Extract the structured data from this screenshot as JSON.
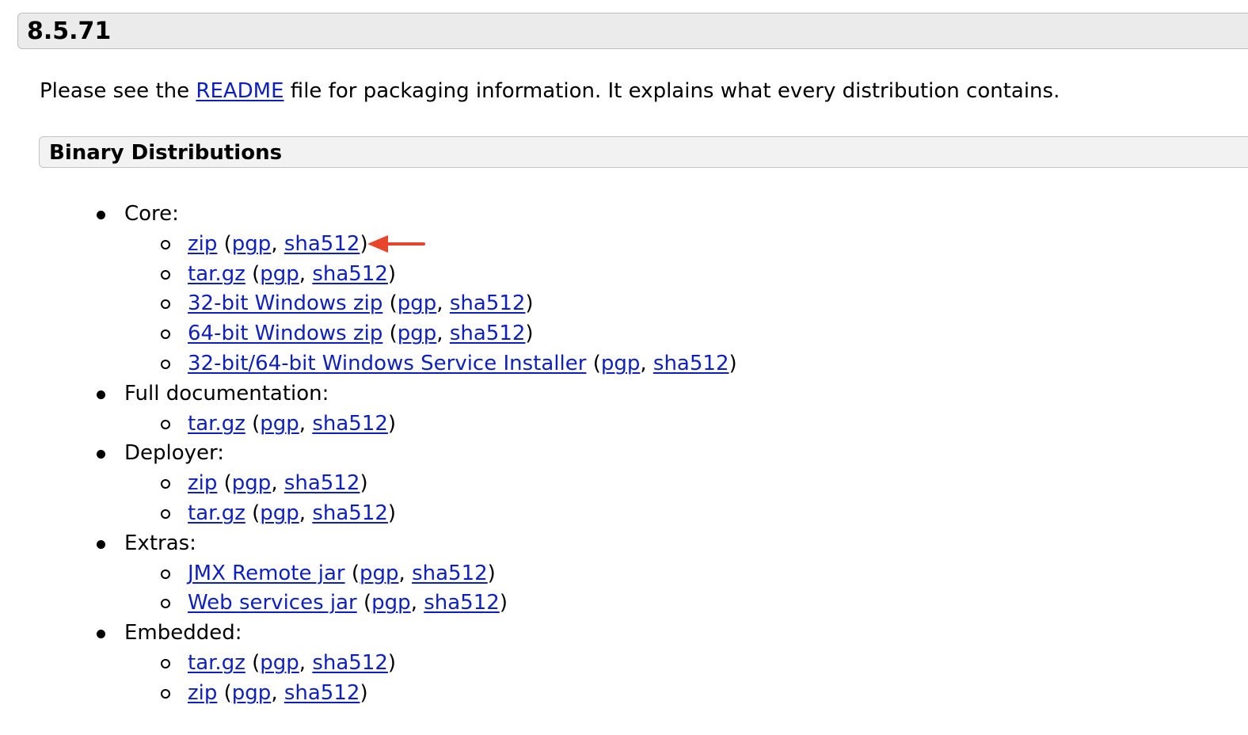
{
  "version": {
    "title": "8.5.71"
  },
  "intro": {
    "before": "Please see the ",
    "link": "README",
    "after": " file for packaging information. It explains what every distribution contains."
  },
  "section": {
    "title": "Binary Distributions"
  },
  "groups": [
    {
      "label": "Core:",
      "items": [
        {
          "name": "zip",
          "pgp": "pgp",
          "sha": "sha512"
        },
        {
          "name": "tar.gz",
          "pgp": "pgp",
          "sha": "sha512"
        },
        {
          "name": "32-bit Windows zip",
          "pgp": "pgp",
          "sha": "sha512"
        },
        {
          "name": "64-bit Windows zip",
          "pgp": "pgp",
          "sha": "sha512"
        },
        {
          "name": "32-bit/64-bit Windows Service Installer",
          "pgp": "pgp",
          "sha": "sha512"
        }
      ]
    },
    {
      "label": "Full documentation:",
      "items": [
        {
          "name": "tar.gz",
          "pgp": "pgp",
          "sha": "sha512"
        }
      ]
    },
    {
      "label": "Deployer:",
      "items": [
        {
          "name": "zip",
          "pgp": "pgp",
          "sha": "sha512"
        },
        {
          "name": "tar.gz",
          "pgp": "pgp",
          "sha": "sha512"
        }
      ]
    },
    {
      "label": "Extras:",
      "items": [
        {
          "name": "JMX Remote jar",
          "pgp": "pgp",
          "sha": "sha512"
        },
        {
          "name": "Web services jar",
          "pgp": "pgp",
          "sha": "sha512"
        }
      ]
    },
    {
      "label": "Embedded:",
      "items": [
        {
          "name": "tar.gz",
          "pgp": "pgp",
          "sha": "sha512"
        },
        {
          "name": "zip",
          "pgp": "pgp",
          "sha": "sha512"
        }
      ]
    }
  ],
  "punctuation": {
    "open": " (",
    "sep": ", ",
    "close": ")"
  },
  "annotation": {
    "arrow_color": "#e8452c",
    "link_color": "#0d1fbf"
  }
}
